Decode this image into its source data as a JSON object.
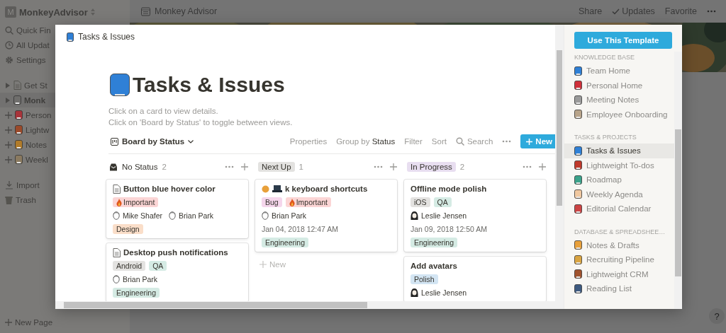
{
  "sidebar": {
    "workspace_initial": "M",
    "workspace": "MonkeyAdvisor",
    "nav": [
      "Quick Fin",
      "All Updat",
      "Settings"
    ],
    "pages": [
      {
        "label": "Get St",
        "selected": false,
        "kind": "expand"
      },
      {
        "label": "Monk",
        "selected": true,
        "kind": "expand"
      },
      {
        "label": "Person",
        "selected": false,
        "kind": "add"
      },
      {
        "label": "Lightw",
        "selected": false,
        "kind": "add"
      },
      {
        "label": "Notes",
        "selected": false,
        "kind": "add"
      },
      {
        "label": "Weekl",
        "selected": false,
        "kind": "add"
      }
    ],
    "tools": [
      "Import",
      "Trash"
    ],
    "new_page": "New Page"
  },
  "topbar": {
    "page": "Monkey Advisor",
    "actions": [
      "Share",
      "Updates",
      "Favorite"
    ]
  },
  "modal": {
    "breadcrumb": "Tasks & Issues",
    "title": "Tasks & Issues",
    "description": [
      "Click on a card to view details.",
      "Click on 'Board by Status' to toggle between views."
    ],
    "view": "Board by Status",
    "toolbar": {
      "properties": "Properties",
      "group_label": "Group by",
      "group_value": "Status",
      "filter": "Filter",
      "sort": "Sort",
      "search": "Search",
      "new": "New"
    },
    "columns": [
      {
        "title": "No Status",
        "kind": "plain",
        "count": "2",
        "cards": [
          {
            "title": "Button blue hover color",
            "kind": "document",
            "rows": [
              {
                "kind": "tags",
                "tags": [
                  {
                    "label": "Important",
                    "color": "#fbd5d5",
                    "flame": true
                  }
                ]
              },
              {
                "kind": "people",
                "people": [
                  {
                    "name": "Mike Shafer",
                    "kind": "outline"
                  },
                  {
                    "name": "Brian Park",
                    "kind": "outline"
                  }
                ]
              },
              {
                "kind": "tags",
                "tags": [
                  {
                    "label": "Design",
                    "color": "#fadec9",
                    "flame": false
                  }
                ]
              }
            ]
          },
          {
            "title": "Desktop push notifications",
            "kind": "document",
            "rows": [
              {
                "kind": "tags",
                "tags": [
                  {
                    "label": "Android",
                    "color": "#e3e2e0",
                    "flame": false
                  },
                  {
                    "label": "QA",
                    "color": "#d5ebe4",
                    "flame": false
                  }
                ]
              },
              {
                "kind": "people",
                "people": [
                  {
                    "name": "Brian Park",
                    "kind": "outline"
                  }
                ]
              },
              {
                "kind": "tags",
                "tags": [
                  {
                    "label": "Engineering",
                    "color": "#d5ebe4",
                    "flame": false
                  }
                ]
              }
            ]
          }
        ]
      },
      {
        "title": "Next Up",
        "kind": "tag",
        "color": "#e3e2e0",
        "count": "1",
        "new": "New",
        "cards": [
          {
            "title": "k keyboard shortcuts",
            "kind": "emoji",
            "rows": [
              {
                "kind": "tags",
                "tags": [
                  {
                    "label": "Bug",
                    "color": "#f5d6ec",
                    "flame": false
                  },
                  {
                    "label": "Important",
                    "color": "#fbd5d5",
                    "flame": true
                  }
                ]
              },
              {
                "kind": "people",
                "people": [
                  {
                    "name": "Brian Park",
                    "kind": "outline"
                  }
                ]
              },
              {
                "kind": "date",
                "text": "Jan 04, 2018 12:47 AM"
              },
              {
                "kind": "tags",
                "tags": [
                  {
                    "label": "Engineering",
                    "color": "#d5ebe4",
                    "flame": false
                  }
                ]
              }
            ]
          }
        ]
      },
      {
        "title": "In Progress",
        "kind": "tag",
        "color": "#e8def0",
        "count": "2",
        "cards": [
          {
            "title": "Offline mode polish",
            "kind": "plain",
            "rows": [
              {
                "kind": "tags",
                "tags": [
                  {
                    "label": "iOS",
                    "color": "#e3e2e0",
                    "flame": false
                  },
                  {
                    "label": "QA",
                    "color": "#d5ebe4",
                    "flame": false
                  }
                ]
              },
              {
                "kind": "people",
                "people": [
                  {
                    "name": "Leslie Jensen",
                    "kind": "dark"
                  }
                ]
              },
              {
                "kind": "date",
                "text": "Jan 09, 2018 12:50 AM"
              },
              {
                "kind": "tags",
                "tags": [
                  {
                    "label": "Engineering",
                    "color": "#d5ebe4",
                    "flame": false
                  }
                ]
              }
            ]
          },
          {
            "title": "Add avatars",
            "kind": "plain",
            "rows": [
              {
                "kind": "tags",
                "tags": [
                  {
                    "label": "Polish",
                    "color": "#d3e5f3",
                    "flame": false
                  }
                ]
              },
              {
                "kind": "people",
                "people": [
                  {
                    "name": "Leslie Jensen",
                    "kind": "dark"
                  }
                ]
              }
            ]
          }
        ]
      }
    ],
    "template_button": "Use This Template",
    "sections": [
      {
        "heading": "KNOWLEDGE BASE",
        "items": [
          {
            "label": "Team Home",
            "selected": false
          },
          {
            "label": "Personal Home",
            "selected": false
          },
          {
            "label": "Meeting Notes",
            "selected": false
          },
          {
            "label": "Employee Onboarding",
            "selected": false
          }
        ]
      },
      {
        "heading": "TASKS & PROJECTS",
        "items": [
          {
            "label": "Tasks & Issues",
            "selected": true
          },
          {
            "label": "Lightweight To-dos",
            "selected": false
          },
          {
            "label": "Roadmap",
            "selected": false
          },
          {
            "label": "Weekly Agenda",
            "selected": false
          },
          {
            "label": "Editorial Calendar",
            "selected": false
          }
        ]
      },
      {
        "heading": "DATABASE & SPREADSHEE…",
        "items": [
          {
            "label": "Notes & Drafts",
            "selected": false
          },
          {
            "label": "Recruiting Pipeline",
            "selected": false
          },
          {
            "label": "Lightweight CRM",
            "selected": false
          },
          {
            "label": "Reading List",
            "selected": false
          }
        ]
      }
    ]
  },
  "help": "?"
}
